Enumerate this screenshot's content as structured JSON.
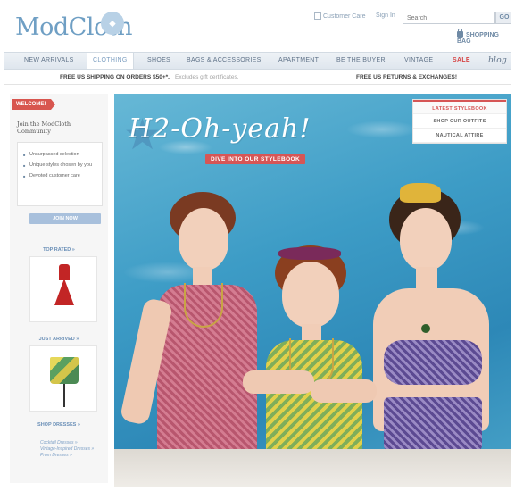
{
  "header": {
    "logo": "ModCloth",
    "customer_care": "Customer Care",
    "sign_in": "Sign In",
    "search_placeholder": "Search",
    "go_label": "GO",
    "bag_label": "SHOPPING BAG"
  },
  "nav": {
    "items": [
      {
        "label": "NEW ARRIVALS"
      },
      {
        "label": "CLOTHING"
      },
      {
        "label": "SHOES"
      },
      {
        "label": "BAGS & ACCESSORIES"
      },
      {
        "label": "APARTMENT"
      },
      {
        "label": "BE THE BUYER"
      },
      {
        "label": "VINTAGE"
      },
      {
        "label": "SALE"
      },
      {
        "label": "blog"
      }
    ],
    "active": "CLOTHING"
  },
  "promo": {
    "shipping": "FREE US SHIPPING ON ORDERS $50+*.",
    "shipping_note": "Excludes gift certificates.",
    "returns": "FREE US RETURNS & EXCHANGES!"
  },
  "sidebar": {
    "welcome": "WELCOME!",
    "join_title": "Join the ModCloth Community",
    "benefits": [
      "Unsurpassed selection",
      "Unique styles chosen by you",
      "Devoted customer care"
    ],
    "join_button": "JOIN NOW",
    "top_rated": "TOP RATED »",
    "just_arrived": "JUST ARRIVED »",
    "shop_dresses": "SHOP DRESSES »",
    "dress_links": [
      "Cocktail Dresses »",
      "Vintage-Inspired Dresses »",
      "Prom Dresses »"
    ]
  },
  "hero": {
    "title": "H2-Oh-yeah!",
    "subtitle": "DIVE INTO OUR STYLEBOOK",
    "tabs": [
      "LATEST STYLEBOOK",
      "SHOP OUR OUTFITS",
      "NAUTICAL ATTIRE"
    ]
  },
  "colors": {
    "accent_blue": "#6f9fc4",
    "sale_red": "#d64545",
    "pool_blue": "#3d9cc6"
  }
}
